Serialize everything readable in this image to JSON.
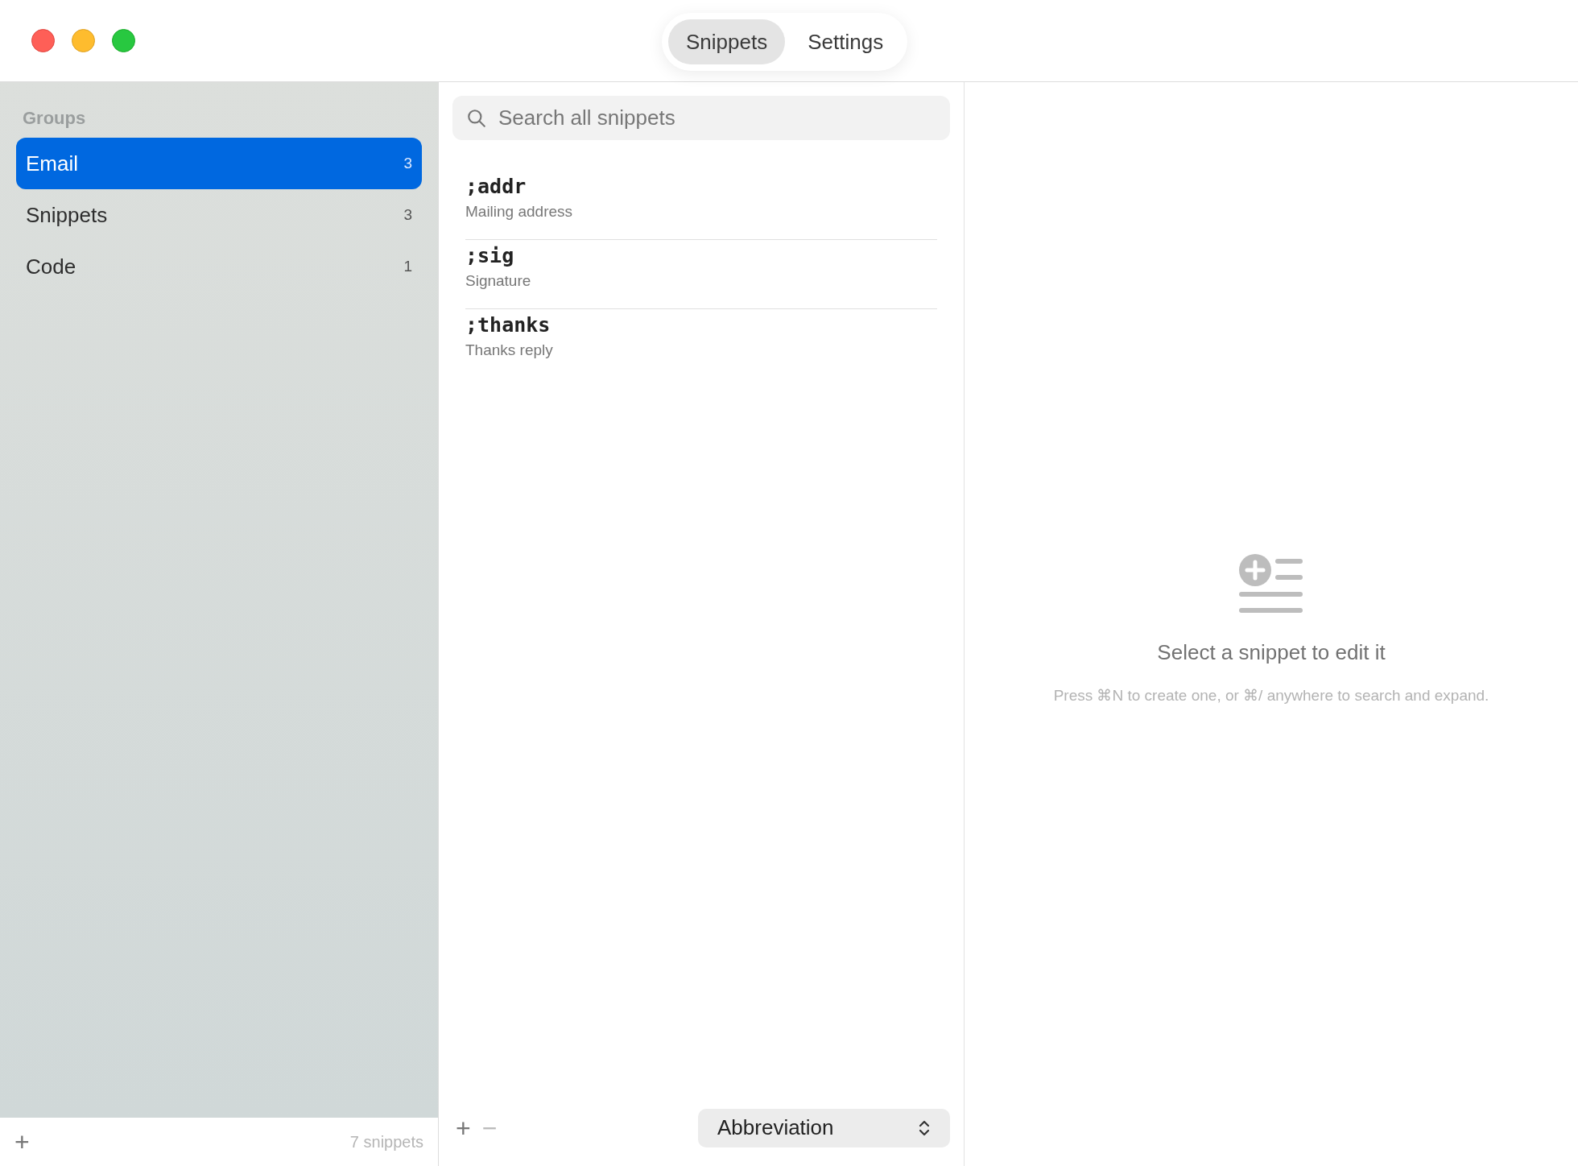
{
  "tabs": [
    {
      "label": "Snippets",
      "selected": true
    },
    {
      "label": "Settings",
      "selected": false
    }
  ],
  "sidebar": {
    "heading": "Groups",
    "items": [
      {
        "label": "Email",
        "count": "3",
        "selected": true
      },
      {
        "label": "Snippets",
        "count": "3",
        "selected": false
      },
      {
        "label": "Code",
        "count": "1",
        "selected": false
      }
    ],
    "footer": {
      "add": "+",
      "count": "7 snippets"
    }
  },
  "search": {
    "placeholder": "Search all snippets"
  },
  "snippets": [
    {
      "abbreviation": ";addr",
      "description": "Mailing address"
    },
    {
      "abbreviation": ";sig",
      "description": "Signature"
    },
    {
      "abbreviation": ";thanks",
      "description": "Thanks reply"
    }
  ],
  "list_footer": {
    "add": "+",
    "remove": "−",
    "sort": "Abbreviation"
  },
  "detail": {
    "title": "Select a snippet to edit it",
    "hint": "Press ⌘N to create one, or ⌘/ anywhere to search and expand."
  }
}
